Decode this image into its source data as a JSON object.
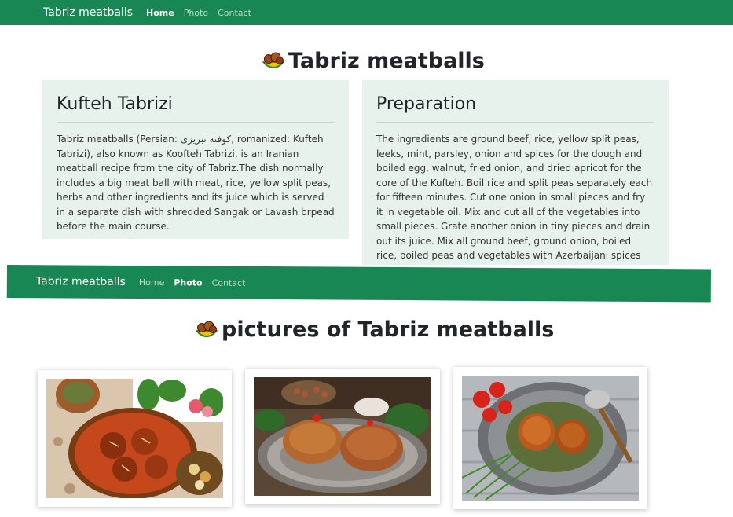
{
  "nav_top": {
    "brand": "Tabriz meatballs",
    "links": [
      "Home",
      "Photo",
      "Contact"
    ]
  },
  "page_title": "Tabriz meatballs",
  "cards": [
    {
      "heading": "Kufteh Tabrizi",
      "text": "Tabriz meatballs (Persian: کوفته تبریزی, romanized: Kufteh Tabrizi), also known as Koofteh Tabrizi, is an Iranian meatball recipe from the city of Tabriz.The dish normally includes a big meat ball with meat, rice, yellow split peas, herbs and other ingredients and its juice which is served in a separate dish with shredded Sangak or Lavash brpead before the main course."
    },
    {
      "heading": "Preparation",
      "text": "The ingredients are ground beef, rice, yellow split peas, leeks, mint, parsley, onion and spices for the dough and boiled egg, walnut, fried onion, and dried apricot for the core of the Kufteh. Boil rice and split peas separately each for fifteen minutes. Cut one onion in small pieces and fry it in vegetable oil. Mix and cut all of the vegetables into small pieces. Grate another onion in tiny pieces and drain out its juice. Mix all ground beef, ground onion, boiled rice, boiled peas and vegetables with Azerbaijani spices and salt and squish them"
    }
  ],
  "nav_second": {
    "brand": "Tabriz meatballs",
    "links": [
      "Home",
      "Photo",
      "Contact"
    ]
  },
  "gallery_title": "pictures of Tabriz meatballs",
  "colors": {
    "navbar": "#198754",
    "card_bg": "#e8f2ec"
  },
  "icons": {
    "title_icon": "meatball-bowl-icon"
  }
}
